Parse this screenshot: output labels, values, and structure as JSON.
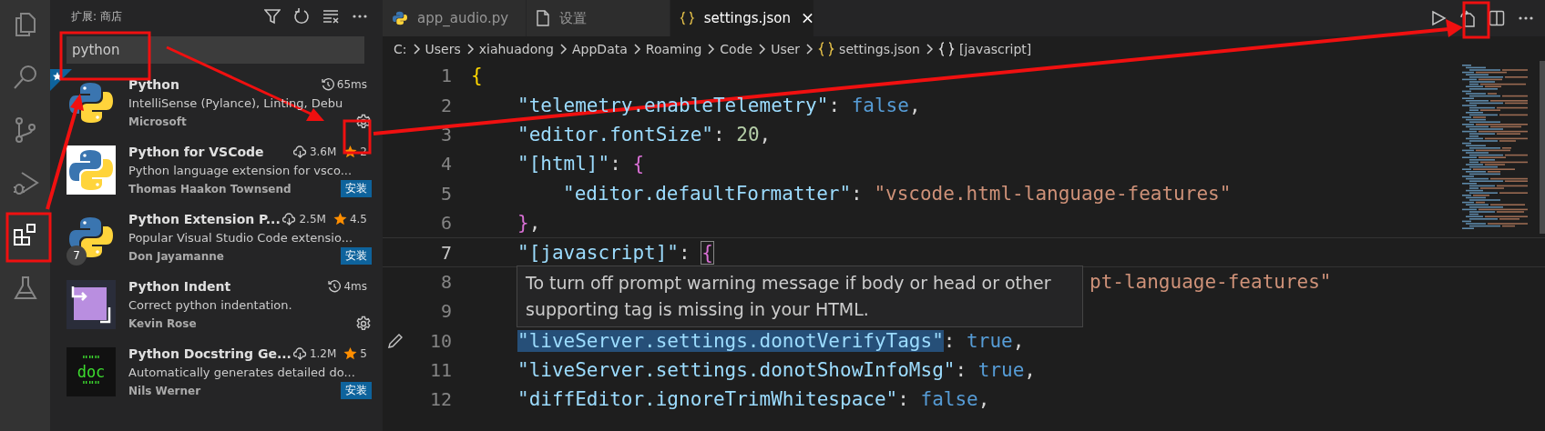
{
  "activity_bar": [
    {
      "kind": "explorer",
      "selected": false
    },
    {
      "kind": "search",
      "selected": false
    },
    {
      "kind": "source-control",
      "selected": false
    },
    {
      "kind": "run-debug",
      "selected": false
    },
    {
      "kind": "extensions",
      "selected": true
    },
    {
      "kind": "testing",
      "selected": false
    }
  ],
  "sidebar": {
    "title": "扩展: 商店",
    "search": {
      "value": "python"
    },
    "extensions": [
      {
        "name": "Python",
        "kind": "installed",
        "recommended": true,
        "stat": "65ms",
        "description": "IntelliSense (Pylance), Linting, Debu",
        "publisher": "Microsoft"
      },
      {
        "name": "Python for VSCode",
        "kind": "marketplace",
        "downloads": "3.6M",
        "rating": "2",
        "description": "Python language extension for vsco...",
        "publisher": "Thomas Haakon Townsend",
        "install": "安装"
      },
      {
        "name": "Python Extension P...",
        "kind": "marketplace",
        "badge": "7",
        "downloads": "2.5M",
        "rating": "4.5",
        "description": "Popular Visual Studio Code extensio...",
        "publisher": "Don Jayamanne",
        "install": "安装"
      },
      {
        "name": "Python Indent",
        "kind": "installed",
        "stat": "4ms",
        "description": "Correct python indentation.",
        "publisher": "Kevin Rose"
      },
      {
        "name": "Python Docstring Ge...",
        "kind": "marketplace",
        "icon_text": [
          "\"\"\"",
          "doc",
          "\"\"\""
        ],
        "downloads": "1.2M",
        "rating": "5",
        "description": "Automatically generates detailed do...",
        "publisher": "Nils Werner",
        "install": "安装"
      }
    ]
  },
  "tabs": [
    {
      "label": "app_audio.py",
      "selected": false
    },
    {
      "label": "设置",
      "selected": false
    },
    {
      "label": "settings.json",
      "selected": true
    }
  ],
  "breadcrumb": [
    {
      "text": "C:"
    },
    {
      "text": "Users"
    },
    {
      "text": "xiahuadong"
    },
    {
      "text": "AppData"
    },
    {
      "text": "Roaming"
    },
    {
      "text": "Code"
    },
    {
      "text": "User"
    },
    {
      "text": "settings.json"
    },
    {
      "text": "[javascript]"
    }
  ],
  "code": [
    {
      "n": "1",
      "current": false,
      "tokens": [
        {
          "kind": "bracket1",
          "text": "{"
        }
      ]
    },
    {
      "n": "2",
      "current": false,
      "tokens": [
        {
          "kind": "key",
          "text": "\"telemetry.enableTelemetry\""
        },
        {
          "kind": "punct",
          "text": ": "
        },
        {
          "kind": "keyword",
          "text": "false"
        },
        {
          "kind": "punct",
          "text": ","
        }
      ]
    },
    {
      "n": "3",
      "current": false,
      "tokens": [
        {
          "kind": "key",
          "text": "\"editor.fontSize\""
        },
        {
          "kind": "punct",
          "text": ": "
        },
        {
          "kind": "number",
          "text": "20"
        },
        {
          "kind": "punct",
          "text": ","
        }
      ]
    },
    {
      "n": "4",
      "current": false,
      "tokens": [
        {
          "kind": "key",
          "text": "\"[html]\""
        },
        {
          "kind": "punct",
          "text": ": "
        },
        {
          "kind": "bracket2",
          "text": "{"
        }
      ]
    },
    {
      "n": "5",
      "current": false,
      "tokens": [
        {
          "kind": "key",
          "text": "\"editor.defaultFormatter\""
        },
        {
          "kind": "punct",
          "text": ": "
        },
        {
          "kind": "string",
          "text": "\"vscode.html-language-features\""
        }
      ]
    },
    {
      "n": "6",
      "current": false,
      "tokens": [
        {
          "kind": "bracket2",
          "text": "}"
        },
        {
          "kind": "punct",
          "text": ","
        }
      ]
    },
    {
      "n": "7",
      "current": true,
      "tokens": [
        {
          "kind": "key",
          "text": "\"[javascript]\""
        },
        {
          "kind": "punct",
          "text": ": "
        },
        {
          "kind": "bracket2",
          "text": "{",
          "highlight": true
        }
      ]
    },
    {
      "n": "8",
      "current": false,
      "kind": "partial",
      "tokens": [
        {
          "kind": "string",
          "text": "pt-language-features\""
        }
      ]
    },
    {
      "n": "9",
      "current": false
    },
    {
      "n": "10",
      "current": false,
      "tokens": [
        {
          "kind": "key",
          "text": "\"liveServer.settings.donotVerifyTags\"",
          "highlight": true
        },
        {
          "kind": "punct",
          "text": ": "
        },
        {
          "kind": "keyword",
          "text": "true"
        },
        {
          "kind": "punct",
          "text": ","
        }
      ]
    },
    {
      "n": "11",
      "current": false,
      "tokens": [
        {
          "kind": "key",
          "text": "\"liveServer.settings.donotShowInfoMsg\""
        },
        {
          "kind": "punct",
          "text": ": "
        },
        {
          "kind": "keyword",
          "text": "true"
        },
        {
          "kind": "punct",
          "text": ","
        }
      ]
    },
    {
      "n": "12",
      "current": false,
      "tokens": [
        {
          "kind": "key",
          "text": "\"diffEditor.ignoreTrimWhitespace\""
        },
        {
          "kind": "punct",
          "text": ": "
        },
        {
          "kind": "keyword",
          "text": "false"
        },
        {
          "kind": "punct",
          "text": ","
        }
      ]
    }
  ],
  "tooltip": "To turn off prompt warning message if body or head or other supporting tag is missing in your HTML."
}
